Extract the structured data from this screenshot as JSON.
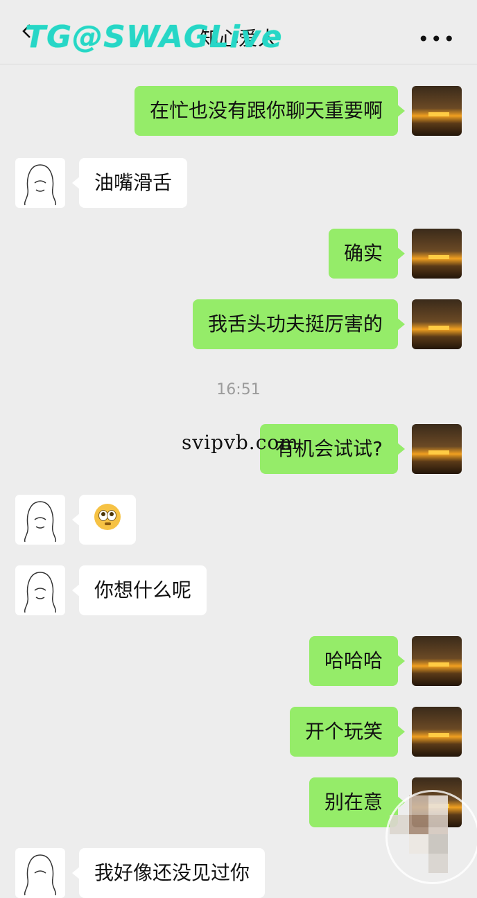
{
  "header": {
    "title": "知心爱人",
    "back_icon": "chevron-left-icon",
    "more_label": "•••",
    "watermark": "TG@SWAGLive"
  },
  "overlay_watermark": "svipvb.com",
  "colors": {
    "my_bubble": "#95ec69",
    "their_bubble": "#ffffff",
    "background": "#ededed"
  },
  "messages": [
    {
      "sender": "me",
      "text": "在忙也没有跟你聊天重要啊"
    },
    {
      "sender": "them",
      "text": "油嘴滑舌"
    },
    {
      "sender": "me",
      "text": "确实"
    },
    {
      "sender": "me",
      "text": "我舌头功夫挺厉害的"
    },
    {
      "type": "time",
      "text": "16:51"
    },
    {
      "sender": "me",
      "text": "有机会试试?"
    },
    {
      "sender": "them",
      "text": "",
      "emoji": "flushed-face-icon"
    },
    {
      "sender": "them",
      "text": "你想什么呢"
    },
    {
      "sender": "me",
      "text": "哈哈哈"
    },
    {
      "sender": "me",
      "text": "开个玩笑"
    },
    {
      "sender": "me",
      "text": "别在意"
    },
    {
      "sender": "them",
      "text": "我好像还没见过你"
    }
  ]
}
